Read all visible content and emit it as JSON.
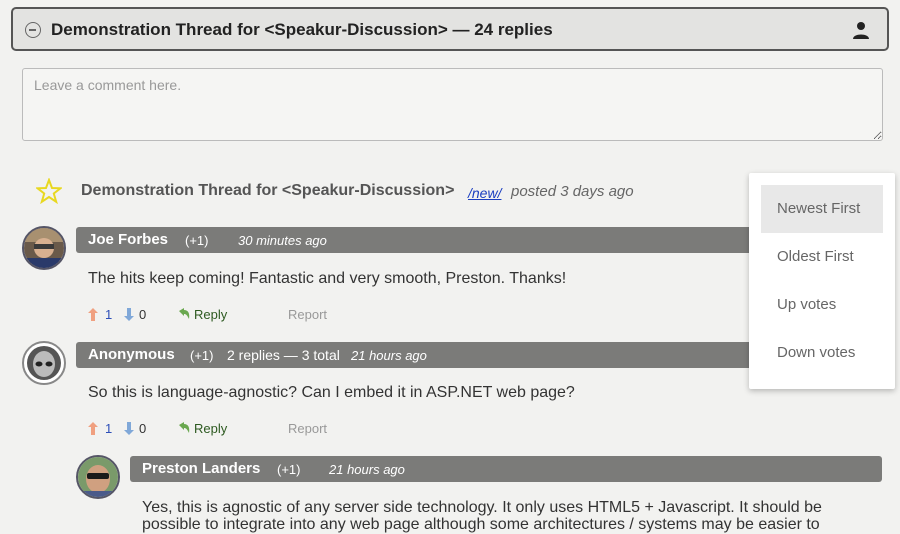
{
  "header": {
    "title": "Demonstration Thread for <Speakur-Discussion> — 24 replies"
  },
  "comment_box": {
    "placeholder": "Leave a comment here."
  },
  "thread": {
    "title": "Demonstration Thread for <Speakur-Discussion>",
    "new_link": "/new/",
    "posted": "posted 3 days ago"
  },
  "sort_menu": {
    "items": [
      "Newest First",
      "Oldest First",
      "Up votes",
      "Down votes"
    ],
    "selected": "Newest First"
  },
  "comments": [
    {
      "author": "Joe Forbes",
      "score": "(+1)",
      "time": "30 minutes ago",
      "text": "The hits keep coming! Fantastic and very smooth, Preston. Thanks!",
      "upvotes": "1",
      "downvotes": "0",
      "reply_label": "Reply",
      "report_label": "Report"
    },
    {
      "author": "Anonymous",
      "score": "(+1)",
      "replies": "2 replies — 3 total",
      "time": "21 hours ago",
      "text": "So this is language-agnostic? Can I embed it in ASP.NET web page?",
      "upvotes": "1",
      "downvotes": "0",
      "reply_label": "Reply",
      "report_label": "Report"
    },
    {
      "author": "Preston Landers",
      "score": "(+1)",
      "time": "21 hours ago",
      "text_line1": "Yes, this is agnostic of any server side technology. It only uses HTML5 + Javascript. It should be",
      "text_line2": "possible to integrate into any web page although some architectures / systems may be easier to"
    }
  ],
  "colors": {
    "header_border": "#555555",
    "author_bar": "#7b7b79",
    "star": "#e8d820",
    "link": "#1a3ec0"
  }
}
